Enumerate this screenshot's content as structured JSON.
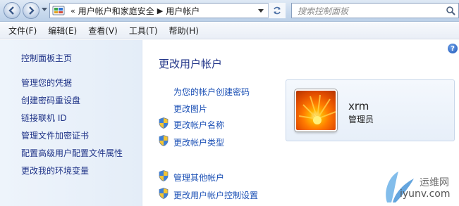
{
  "address": {
    "breadcrumb_prefix": "«",
    "crumbs": [
      "用户帐户和家庭安全",
      "用户帐户"
    ],
    "crumb_separator": "▶"
  },
  "search": {
    "placeholder": "搜索控制面板"
  },
  "menu": [
    "文件(F)",
    "编辑(E)",
    "查看(V)",
    "工具(T)",
    "帮助(H)"
  ],
  "sidebar": {
    "home": "控制面板主页",
    "items": [
      "管理您的凭据",
      "创建密码重设盘",
      "链接联机 ID",
      "管理文件加密证书",
      "配置高级用户配置文件属性",
      "更改我的环境变量"
    ]
  },
  "main": {
    "heading": "更改用户帐户",
    "links": [
      {
        "label": "为您的帐户创建密码",
        "shield": false
      },
      {
        "label": "更改图片",
        "shield": false
      },
      {
        "label": "更改帐户名称",
        "shield": true
      },
      {
        "label": "更改帐户类型",
        "shield": true
      }
    ],
    "other_links": [
      {
        "label": "管理其他帐户",
        "shield": true
      },
      {
        "label": "更改用户帐户控制设置",
        "shield": true
      }
    ]
  },
  "user": {
    "name": "xrm",
    "role": "管理员"
  },
  "watermark": {
    "title": "运维网",
    "url": "iyunv.com"
  },
  "icons": {
    "back": "back-arrow-icon",
    "forward": "forward-arrow-icon",
    "control_panel": "control-panel-icon",
    "refresh": "refresh-icon",
    "search": "search-icon",
    "help": "help-icon",
    "shield": "uac-shield-icon"
  },
  "colors": {
    "link": "#1a4fb5",
    "heading": "#1e3287",
    "sidebar_bg": "#e9f0f9"
  }
}
